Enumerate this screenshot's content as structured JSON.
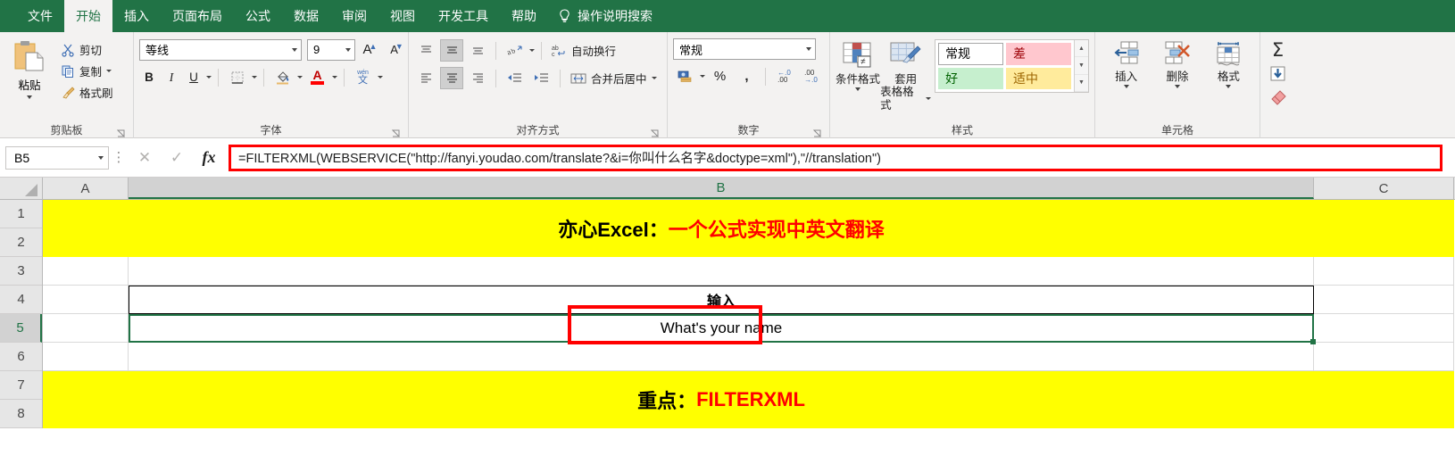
{
  "window": {
    "accent_green": "#217346",
    "highlight_yellow": "#ffff00",
    "highlight_red": "#ff0000"
  },
  "tabs": [
    {
      "label": "文件",
      "active": false
    },
    {
      "label": "开始",
      "active": true
    },
    {
      "label": "插入",
      "active": false
    },
    {
      "label": "页面布局",
      "active": false
    },
    {
      "label": "公式",
      "active": false
    },
    {
      "label": "数据",
      "active": false
    },
    {
      "label": "审阅",
      "active": false
    },
    {
      "label": "视图",
      "active": false
    },
    {
      "label": "开发工具",
      "active": false
    },
    {
      "label": "帮助",
      "active": false
    }
  ],
  "tell_me": {
    "label": "操作说明搜索",
    "icon": "lightbulb-icon"
  },
  "ribbon": {
    "clipboard": {
      "title": "剪贴板",
      "paste": "粘贴",
      "cut": "剪切",
      "copy": "复制",
      "format_painter": "格式刷"
    },
    "font": {
      "title": "字体",
      "font_name": "等线",
      "font_size": "9",
      "grow": "A",
      "shrink": "A",
      "bold": "B",
      "italic": "I",
      "underline": "U",
      "phonetic": "文"
    },
    "alignment": {
      "title": "对齐方式",
      "wrap_text": "自动换行",
      "merge_center": "合并后居中"
    },
    "number": {
      "title": "数字",
      "format": "常规",
      "percent": "%",
      "comma": ","
    },
    "styles": {
      "title": "样式",
      "conditional_formatting": "条件格式",
      "format_as_table_l1": "套用",
      "format_as_table_l2": "表格格式",
      "gallery": [
        {
          "label": "常规",
          "kind": "normal"
        },
        {
          "label": "差",
          "kind": "bad"
        },
        {
          "label": "好",
          "kind": "good"
        },
        {
          "label": "适中",
          "kind": "neutral"
        }
      ]
    },
    "cells": {
      "title": "单元格",
      "insert": "插入",
      "delete": "删除",
      "format": "格式"
    },
    "editing": {
      "autosum": "Σ",
      "fill": "fill-icon",
      "clear": "clear-icon"
    }
  },
  "formula_bar": {
    "name_box": "B5",
    "cancel_icon": "close-icon",
    "enter_icon": "check-icon",
    "fx_icon": "fx-icon",
    "formula": "=FILTERXML(WEBSERVICE(\"http://fanyi.youdao.com/translate?&i=你叫什么名字&doctype=xml\"),\"//translation\")"
  },
  "sheet": {
    "columns": [
      "A",
      "B",
      "C"
    ],
    "selected_column": "B",
    "rows": [
      "1",
      "2",
      "3",
      "4",
      "5",
      "6",
      "7",
      "8"
    ],
    "selected_row": "5",
    "title_banner": {
      "prefix": "亦心Excel：",
      "emphasis": "一个公式实现中英文翻译"
    },
    "input_label": "输入",
    "b5_value": "What's your name",
    "key_banner": {
      "prefix": "重点：",
      "emphasis": "FILTERXML"
    }
  }
}
